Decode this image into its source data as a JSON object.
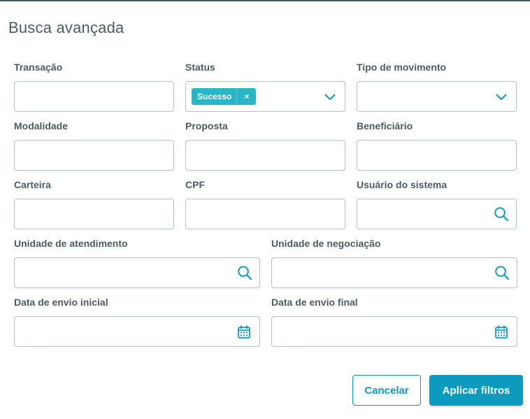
{
  "dialog": {
    "title": "Busca avançada"
  },
  "fields": {
    "transacao": {
      "label": "Transação",
      "value": ""
    },
    "status": {
      "label": "Status",
      "tag": "Sucesso",
      "tag_close": "×"
    },
    "tipo_movimento": {
      "label": "Tipo de movimento",
      "value": ""
    },
    "modalidade": {
      "label": "Modalidade",
      "value": ""
    },
    "proposta": {
      "label": "Proposta",
      "value": ""
    },
    "beneficiario": {
      "label": "Beneficiário",
      "value": ""
    },
    "carteira": {
      "label": "Carteira",
      "value": ""
    },
    "cpf": {
      "label": "CPF",
      "value": ""
    },
    "usuario_sistema": {
      "label": "Usuário do sistema",
      "value": "",
      "icon": "search-icon"
    },
    "unidade_atendimento": {
      "label": "Unidade de atendimento",
      "value": "",
      "icon": "search-icon"
    },
    "unidade_negociacao": {
      "label": "Unidade de negociação",
      "value": "",
      "icon": "search-icon"
    },
    "data_envio_inicial": {
      "label": "Data de envio inicial",
      "value": "",
      "icon": "calendar-icon"
    },
    "data_envio_final": {
      "label": "Data de envio final",
      "value": "",
      "icon": "calendar-icon"
    }
  },
  "actions": {
    "cancel_label": "Cancelar",
    "apply_label": "Aplicar filtros"
  },
  "colors": {
    "accent": "#0c9abe",
    "tag": "#29b6c5",
    "text": "#4a5c60",
    "border": "#b7c0c2"
  }
}
